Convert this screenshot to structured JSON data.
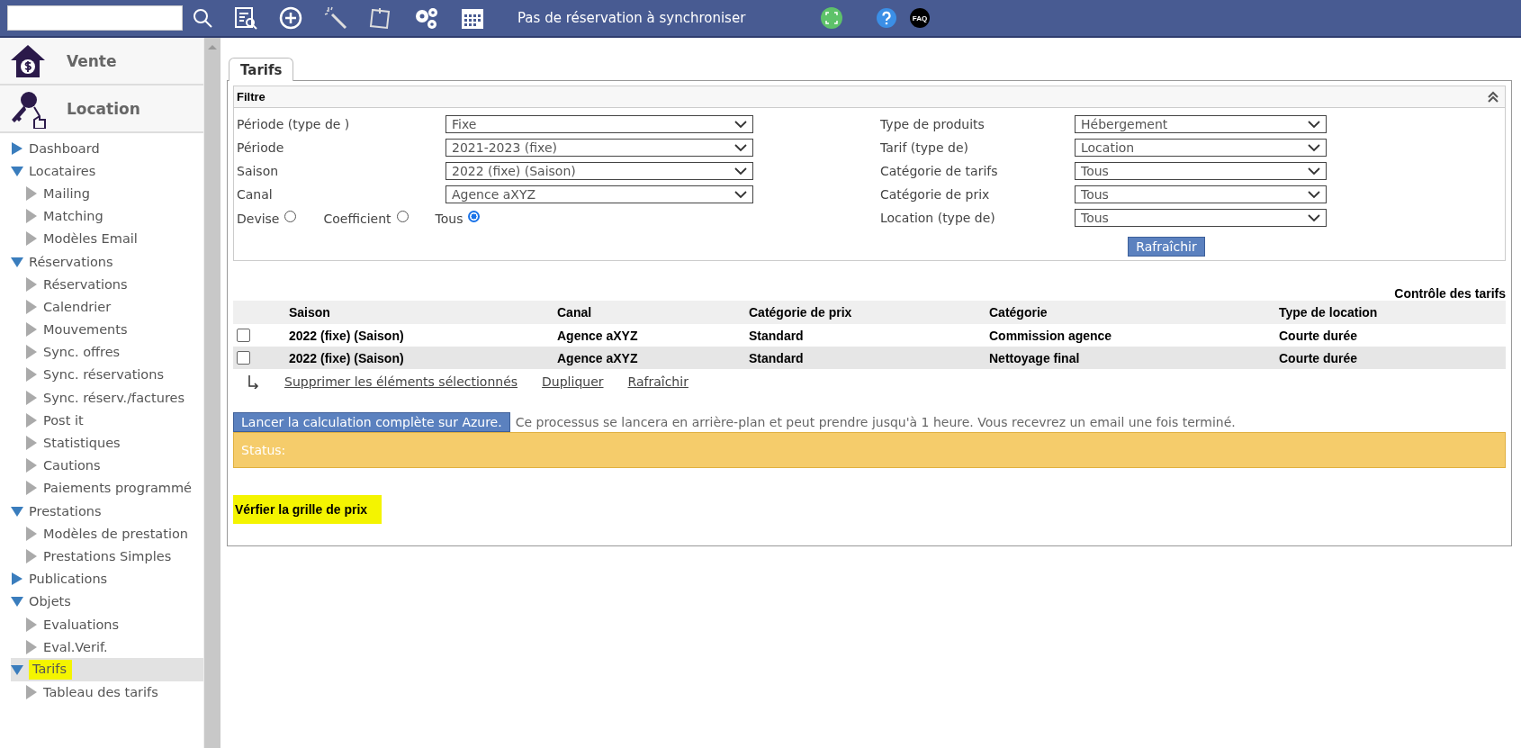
{
  "topbar": {
    "status_text": "Pas de réservation à synchroniser",
    "faq_label": "FAQ"
  },
  "sidebar": {
    "modules": [
      {
        "label": "Vente",
        "kind": "sale"
      },
      {
        "label": "Location",
        "kind": "rental"
      }
    ],
    "items": [
      {
        "label": "Dashboard",
        "expanded": false,
        "selected": false,
        "highlighted": false
      },
      {
        "label": "Locataires",
        "expanded": true,
        "selected": false,
        "highlighted": false,
        "children": [
          {
            "label": "Mailing"
          },
          {
            "label": "Matching"
          },
          {
            "label": "Modèles Email"
          }
        ]
      },
      {
        "label": "Réservations",
        "expanded": true,
        "selected": false,
        "highlighted": false,
        "children": [
          {
            "label": "Réservations"
          },
          {
            "label": "Calendrier"
          },
          {
            "label": "Mouvements"
          },
          {
            "label": "Sync. offres"
          },
          {
            "label": "Sync. réservations"
          },
          {
            "label": "Sync. réserv./factures"
          },
          {
            "label": "Post it"
          },
          {
            "label": "Statistiques"
          },
          {
            "label": "Cautions"
          },
          {
            "label": "Paiements programmé"
          }
        ]
      },
      {
        "label": "Prestations",
        "expanded": true,
        "selected": false,
        "highlighted": false,
        "children": [
          {
            "label": "Modèles de prestation"
          },
          {
            "label": "Prestations Simples"
          }
        ]
      },
      {
        "label": "Publications",
        "expanded": false,
        "selected": false,
        "highlighted": false
      },
      {
        "label": "Objets",
        "expanded": true,
        "selected": false,
        "highlighted": false,
        "children": [
          {
            "label": "Evaluations"
          },
          {
            "label": "Eval.Verif."
          }
        ]
      },
      {
        "label": "Tarifs",
        "expanded": true,
        "selected": true,
        "highlighted": true,
        "children": [
          {
            "label": "Tableau des tarifs"
          }
        ]
      }
    ]
  },
  "tabs": [
    {
      "label": "Tarifs",
      "selected": true
    }
  ],
  "filter": {
    "title": "Filtre",
    "expanded": true,
    "left_fields": [
      {
        "label": "Période (type de )",
        "value": "Fixe"
      },
      {
        "label": "Période",
        "value": "2021-2023 (fixe)"
      },
      {
        "label": "Saison",
        "value": "2022 (fixe) (Saison)"
      },
      {
        "label": "Canal",
        "value": "Agence aXYZ"
      }
    ],
    "radios": [
      {
        "label": "Devise",
        "selected": false
      },
      {
        "label": "Coefficient",
        "selected": false
      },
      {
        "label": "Tous",
        "selected": true
      }
    ],
    "right_fields": [
      {
        "label": "Type de produits",
        "value": "Hébergement"
      },
      {
        "label": "Tarif (type de)",
        "value": "Location"
      },
      {
        "label": "Catégorie de tarifs",
        "value": "Tous"
      },
      {
        "label": "Catégorie de prix",
        "value": "Tous"
      },
      {
        "label": "Location (type de)",
        "value": "Tous"
      }
    ],
    "refresh_button": "Rafraîchir"
  },
  "table": {
    "title": "Contrôle des tarifs",
    "columns": [
      "Saison",
      "Canal",
      "Catégorie de prix",
      "Catégorie",
      "Type de location"
    ],
    "rows": [
      {
        "checked": false,
        "cells": [
          "2022 (fixe) (Saison)",
          "Agence aXYZ",
          "Standard",
          "Commission agence",
          "Courte durée"
        ]
      },
      {
        "checked": false,
        "cells": [
          "2022 (fixe) (Saison)",
          "Agence aXYZ",
          "Standard",
          "Nettoyage final",
          "Courte durée"
        ]
      }
    ],
    "actions": [
      "Supprimer les éléments sélectionnés",
      "Dupliquer",
      "Rafraîchir"
    ]
  },
  "azure": {
    "button": "Lancer la calculation complète sur Azure.",
    "note": "Ce processus se lancera en arrière-plan et peut prendre jusqu'à 1 heure. Vous recevrez un email une fois terminé."
  },
  "status": {
    "label": "Status:"
  },
  "verify_link": {
    "label": "Vérfier la grille de prix",
    "highlighted": true
  }
}
